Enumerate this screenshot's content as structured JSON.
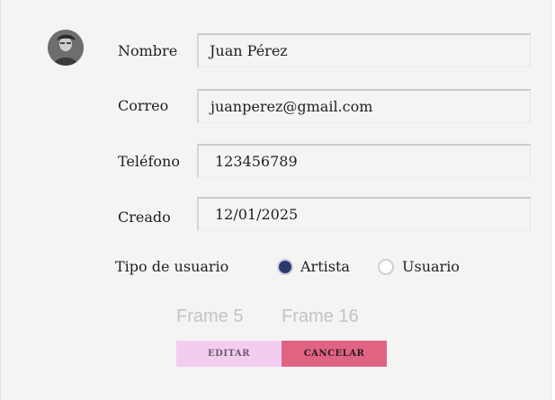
{
  "form": {
    "fields": [
      {
        "label": "Nombre",
        "value": "Juan Pérez"
      },
      {
        "label": "Correo",
        "value": "juanperez@gmail.com"
      },
      {
        "label": "Teléfono",
        "value": "123456789"
      },
      {
        "label": "Creado",
        "value": "12/01/2025"
      }
    ],
    "user_type": {
      "label": "Tipo de usuario",
      "options": [
        {
          "label": "Artista",
          "selected": true
        },
        {
          "label": "Usuario",
          "selected": false
        }
      ]
    }
  },
  "frames": {
    "left": "Frame 5",
    "right": "Frame 16"
  },
  "buttons": {
    "edit": "EDITAR",
    "cancel": "CANCELAR"
  },
  "colors": {
    "background": "#f4f4f3",
    "radio_selected": "#2b3a6b",
    "edit_button": "#f3cdf0",
    "cancel_button": "#e06482"
  },
  "icons": {
    "avatar": "user-avatar-icon"
  }
}
